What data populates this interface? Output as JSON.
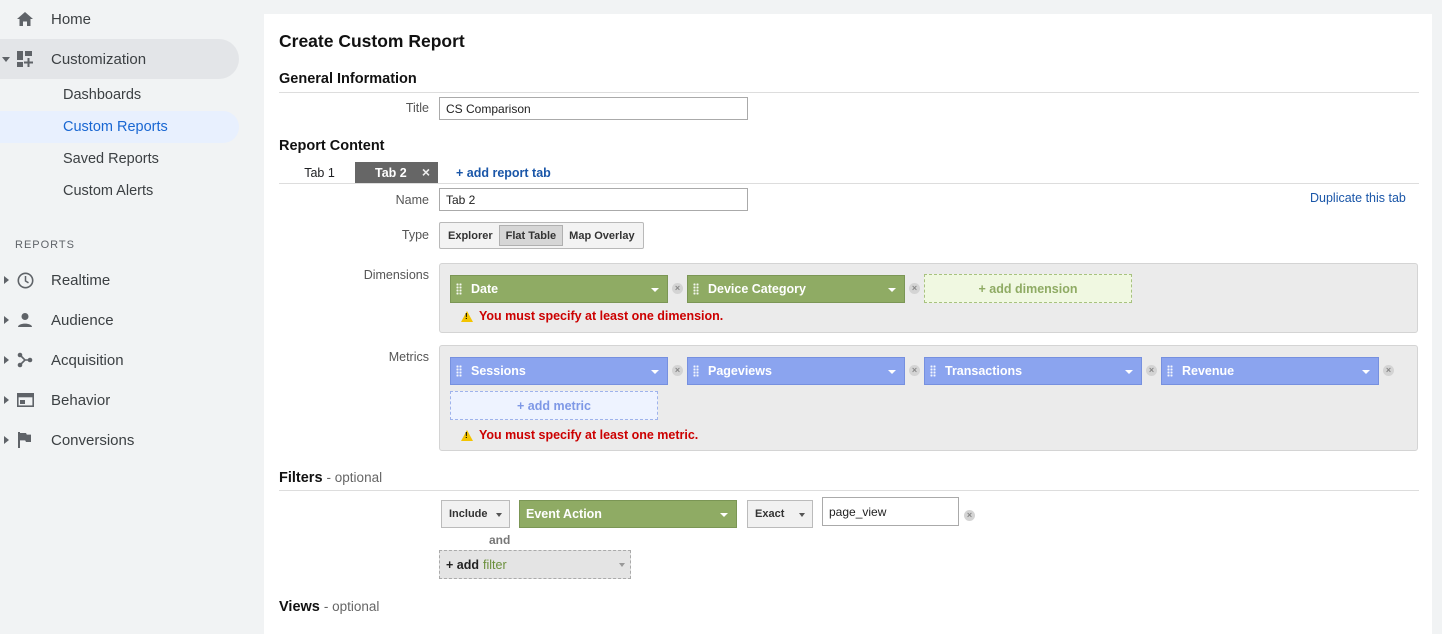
{
  "sidebar": {
    "home": "Home",
    "customization": "Customization",
    "sub_items": [
      "Dashboards",
      "Custom Reports",
      "Saved Reports",
      "Custom Alerts"
    ],
    "reports_heading": "REPORTS",
    "reports": [
      "Realtime",
      "Audience",
      "Acquisition",
      "Behavior",
      "Conversions"
    ]
  },
  "main": {
    "title": "Create Custom Report",
    "general_heading": "General Information",
    "title_label": "Title",
    "title_value": "CS Comparison",
    "report_content_heading": "Report Content",
    "tabs": [
      "Tab 1",
      "Tab 2"
    ],
    "add_tab": "+ add report tab",
    "close_glyph": "×",
    "name_label": "Name",
    "name_value": "Tab 2",
    "duplicate_tab": "Duplicate this tab",
    "type_label": "Type",
    "types": [
      "Explorer",
      "Flat Table",
      "Map Overlay"
    ],
    "selected_type": "Flat Table",
    "dimensions_label": "Dimensions",
    "dimensions": [
      "Date",
      "Device Category"
    ],
    "add_dimension": "+ add dimension",
    "dimension_error": "You must specify at least one dimension.",
    "metrics_label": "Metrics",
    "metrics": [
      "Sessions",
      "Pageviews",
      "Transactions",
      "Revenue"
    ],
    "add_metric": "+ add metric",
    "metric_error": "You must specify at least one metric.",
    "filters_heading": "Filters",
    "optional": "- optional",
    "filter": {
      "include": "Include",
      "dimension": "Event Action",
      "match": "Exact",
      "value": "page_view",
      "and": "and",
      "add_prefix": "+ add",
      "add_word": "filter"
    },
    "views_heading": "Views"
  },
  "colors": {
    "dimension_chip": "#8fab64",
    "metric_chip": "#8ba4ef",
    "error": "#cc0000",
    "link": "#1a56a8",
    "active_nav": "#1967d2"
  }
}
